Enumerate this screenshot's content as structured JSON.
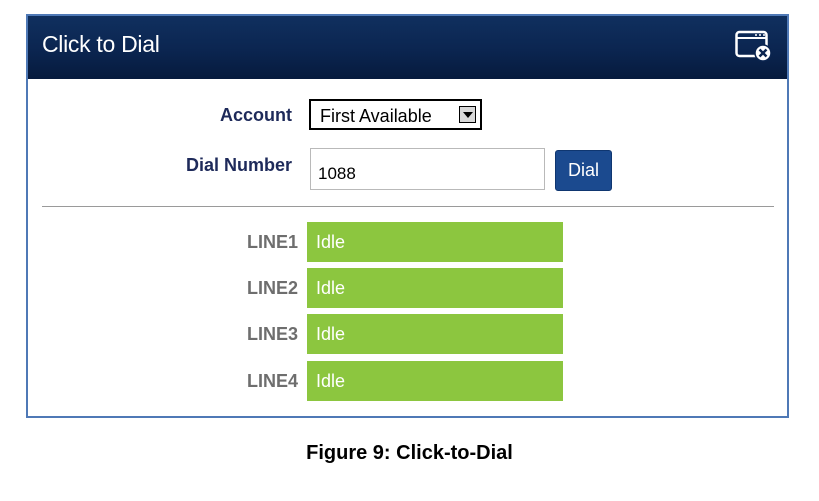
{
  "dialog": {
    "title": "Click to Dial",
    "close_icon": "window-close-icon"
  },
  "form": {
    "account_label": "Account",
    "account_value": "First Available",
    "dial_number_label": "Dial Number",
    "dial_number_value": "1088",
    "dial_button_label": "Dial"
  },
  "lines": [
    {
      "label": "LINE1",
      "status": "Idle"
    },
    {
      "label": "LINE2",
      "status": "Idle"
    },
    {
      "label": "LINE3",
      "status": "Idle"
    },
    {
      "label": "LINE4",
      "status": "Idle"
    }
  ],
  "colors": {
    "title_bar": "#0b2550",
    "status_idle": "#8cc63f",
    "dial_button": "#1b4a8f",
    "dialog_border": "#4f79b6"
  },
  "caption": "Figure 9: Click-to-Dial"
}
